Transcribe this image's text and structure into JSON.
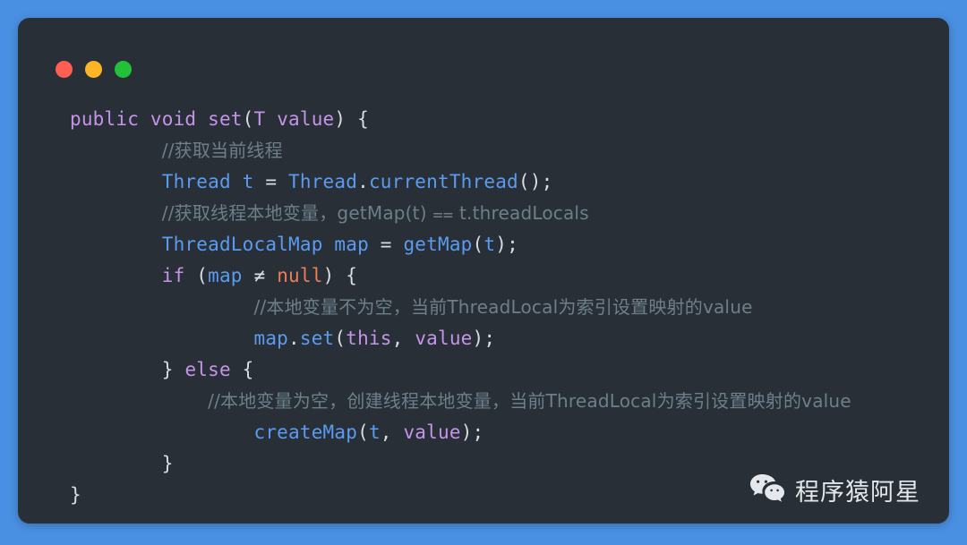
{
  "window": {
    "controls": [
      {
        "name": "close",
        "color": "#ff5f52"
      },
      {
        "name": "minimize",
        "color": "#fcb524"
      },
      {
        "name": "maximize",
        "color": "#23c03a"
      }
    ],
    "background_color": "#4a90e2",
    "card_color": "#282f36"
  },
  "theme": {
    "keyword_color": "#c593e8",
    "type_color": "#5b9bf0",
    "punctuation_color": "#d7dde3",
    "literal_color": "#ef7d57",
    "comment_color": "#6e7f8a"
  },
  "code": {
    "language": "java",
    "lines": [
      {
        "indent": 0,
        "text": "public void set(T value) {",
        "tokens": [
          {
            "t": "public",
            "c": "kw"
          },
          {
            "t": " ",
            "c": "pun"
          },
          {
            "t": "void",
            "c": "kw"
          },
          {
            "t": " ",
            "c": "pun"
          },
          {
            "t": "set",
            "c": "kw"
          },
          {
            "t": "(",
            "c": "pun"
          },
          {
            "t": "T",
            "c": "kw"
          },
          {
            "t": " ",
            "c": "pun"
          },
          {
            "t": "value",
            "c": "kw"
          },
          {
            "t": ")",
            "c": "pun"
          },
          {
            "t": " ",
            "c": "pun"
          },
          {
            "t": "{",
            "c": "pun"
          }
        ]
      },
      {
        "indent": 2,
        "text": "//获取当前线程",
        "tokens": [
          {
            "t": "//获取当前线程",
            "c": "cmt"
          }
        ]
      },
      {
        "indent": 2,
        "text": "Thread t = Thread.currentThread();",
        "tokens": [
          {
            "t": "Thread",
            "c": "typ"
          },
          {
            "t": " ",
            "c": "pun"
          },
          {
            "t": "t",
            "c": "typ"
          },
          {
            "t": " ",
            "c": "pun"
          },
          {
            "t": "=",
            "c": "pun"
          },
          {
            "t": " ",
            "c": "pun"
          },
          {
            "t": "Thread",
            "c": "typ"
          },
          {
            "t": ".",
            "c": "pun"
          },
          {
            "t": "currentThread",
            "c": "typ"
          },
          {
            "t": "()",
            "c": "pun"
          },
          {
            "t": ";",
            "c": "pun"
          }
        ]
      },
      {
        "indent": 2,
        "text": "//获取线程本地变量，getMap(t) == t.threadLocals",
        "tokens": [
          {
            "t": "//获取线程本地变量，getMap(t) ⩵ t.threadLocals",
            "c": "cmt"
          }
        ]
      },
      {
        "indent": 2,
        "text": "ThreadLocalMap map = getMap(t);",
        "tokens": [
          {
            "t": "ThreadLocalMap",
            "c": "typ"
          },
          {
            "t": " ",
            "c": "pun"
          },
          {
            "t": "map",
            "c": "typ"
          },
          {
            "t": " ",
            "c": "pun"
          },
          {
            "t": "=",
            "c": "pun"
          },
          {
            "t": " ",
            "c": "pun"
          },
          {
            "t": "getMap",
            "c": "typ"
          },
          {
            "t": "(",
            "c": "pun"
          },
          {
            "t": "t",
            "c": "typ"
          },
          {
            "t": ")",
            "c": "pun"
          },
          {
            "t": ";",
            "c": "pun"
          }
        ]
      },
      {
        "indent": 2,
        "text": "if (map != null) {",
        "tokens": [
          {
            "t": "if",
            "c": "kw"
          },
          {
            "t": " (",
            "c": "pun"
          },
          {
            "t": "map",
            "c": "typ"
          },
          {
            "t": " ≠ ",
            "c": "pun"
          },
          {
            "t": "null",
            "c": "lit"
          },
          {
            "t": ") {",
            "c": "pun"
          }
        ]
      },
      {
        "indent": 4,
        "text": "//本地变量不为空，当前ThreadLocal为索引设置映射的value",
        "tokens": [
          {
            "t": "//本地变量不为空，当前ThreadLocal为索引设置映射的value",
            "c": "cmt"
          }
        ]
      },
      {
        "indent": 4,
        "text": "map.set(this, value);",
        "tokens": [
          {
            "t": "map",
            "c": "typ"
          },
          {
            "t": ".",
            "c": "pun"
          },
          {
            "t": "set",
            "c": "typ"
          },
          {
            "t": "(",
            "c": "pun"
          },
          {
            "t": "this",
            "c": "kw"
          },
          {
            "t": ", ",
            "c": "pun"
          },
          {
            "t": "value",
            "c": "kw"
          },
          {
            "t": ")",
            "c": "pun"
          },
          {
            "t": ";",
            "c": "pun"
          }
        ]
      },
      {
        "indent": 2,
        "text": "} else {",
        "tokens": [
          {
            "t": "}",
            "c": "pun"
          },
          {
            "t": " ",
            "c": "pun"
          },
          {
            "t": "else",
            "c": "kw"
          },
          {
            "t": " ",
            "c": "pun"
          },
          {
            "t": "{",
            "c": "pun"
          }
        ]
      },
      {
        "indent": 3,
        "text": "//本地变量为空，创建线程本地变量，当前ThreadLocal为索引设置映射的value",
        "tokens": [
          {
            "t": "//本地变量为空，创建线程本地变量，当前ThreadLocal为索引设置映射的value",
            "c": "cmt"
          }
        ]
      },
      {
        "indent": 4,
        "text": "createMap(t, value);",
        "tokens": [
          {
            "t": "createMap",
            "c": "typ"
          },
          {
            "t": "(",
            "c": "pun"
          },
          {
            "t": "t",
            "c": "typ"
          },
          {
            "t": ", ",
            "c": "pun"
          },
          {
            "t": "value",
            "c": "kw"
          },
          {
            "t": ")",
            "c": "pun"
          },
          {
            "t": ";",
            "c": "pun"
          }
        ]
      },
      {
        "indent": 2,
        "text": "}",
        "tokens": [
          {
            "t": "}",
            "c": "pun"
          }
        ]
      },
      {
        "indent": 0,
        "text": "}",
        "tokens": [
          {
            "t": "}",
            "c": "pun"
          }
        ]
      }
    ]
  },
  "watermark": {
    "icon": "wechat-icon",
    "label": "程序猿阿星"
  }
}
